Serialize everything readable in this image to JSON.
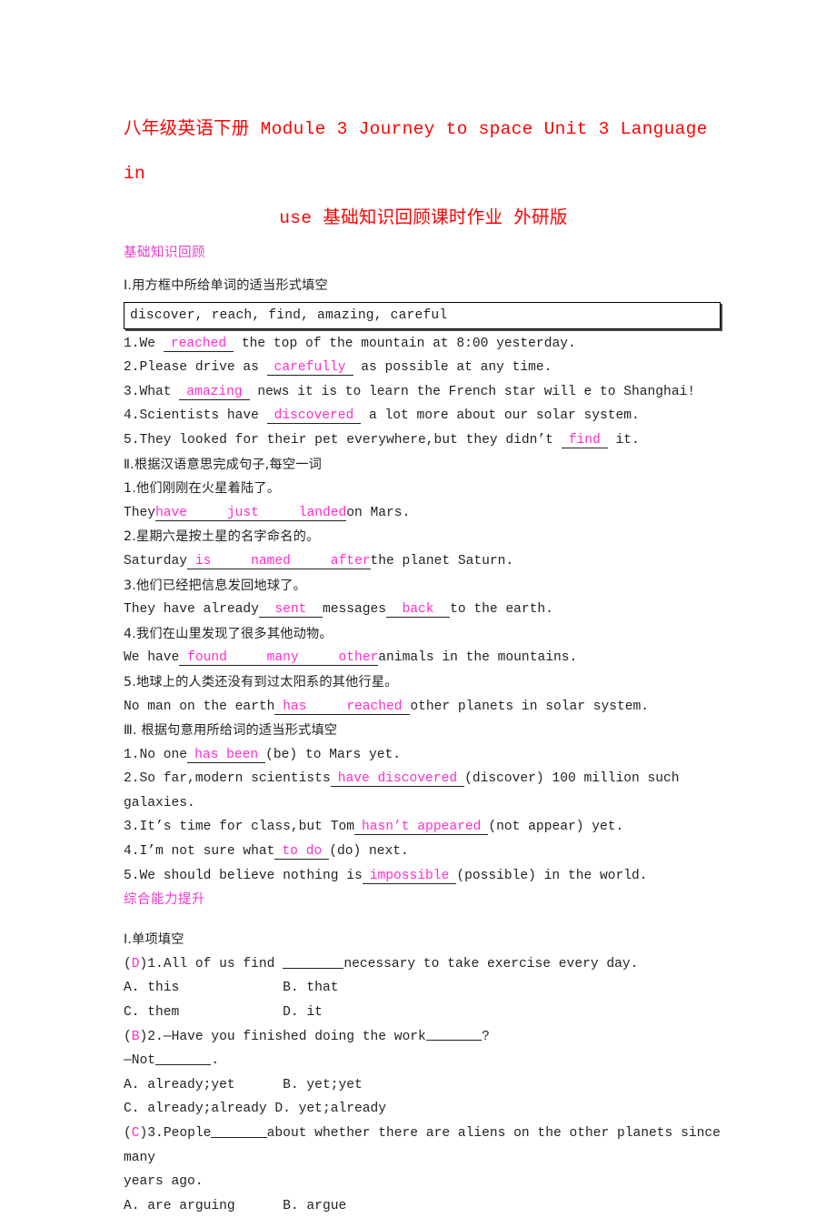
{
  "document": {
    "title_line1": "八年级英语下册 Module 3 Journey to space Unit 3 Language in",
    "title_line2": "use 基础知识回顾课时作业 外研版",
    "title_color": "#ff0000",
    "accent_color": "#ff2bd0",
    "header_color": "#ea3ad0"
  },
  "sections": {
    "basics_header": "基础知识回顾",
    "advanced_header": "综合能力提升"
  },
  "part1": {
    "heading": "Ⅰ.用方框中所给单词的适当形式填空",
    "word_bank": "discover, reach, find, amazing, careful",
    "items": [
      {
        "num": "1.",
        "before": "We ",
        "answer": "reached",
        "after": " the top of the mountain at 8:00 yesterday."
      },
      {
        "num": "2.",
        "before": "Please drive as ",
        "answer": "carefully",
        "after": " as possible at any time."
      },
      {
        "num": "3.",
        "before": "What ",
        "answer": "amazing",
        "after": " news it is to learn the French star will e to Shanghai!"
      },
      {
        "num": "4.",
        "before": "Scientists have ",
        "answer": "discovered",
        "after": " a lot more about our solar system."
      },
      {
        "num": "5.",
        "before": "They looked for their pet everywhere,but they didn’t ",
        "answer": "find",
        "after": " it."
      }
    ]
  },
  "part2": {
    "heading": "Ⅱ.根据汉语意思完成句子,每空一词",
    "items": [
      {
        "num": "1.",
        "chinese": "他们刚刚在火星着陆了。",
        "before": "They",
        "words": [
          "have",
          "just",
          "landed"
        ],
        "after": "on Mars."
      },
      {
        "num": "2.",
        "chinese": "星期六是按土星的名字命名的。",
        "before": "Saturday",
        "words": [
          "is",
          "named",
          "after"
        ],
        "after": "the planet Saturn."
      },
      {
        "num": "3.",
        "chinese": "他们已经把信息发回地球了。",
        "before": "They have already",
        "words": [
          "sent"
        ],
        "middle": "messages",
        "words2": [
          "back"
        ],
        "after": "to the earth."
      },
      {
        "num": "4.",
        "chinese": "我们在山里发现了很多其他动物。",
        "before": "We have",
        "words": [
          "found",
          "many",
          "other"
        ],
        "after": "animals in the mountains."
      },
      {
        "num": "5.",
        "chinese": "地球上的人类还没有到过太阳系的其他行星。",
        "before": "No man on the earth",
        "words": [
          "has",
          "reached"
        ],
        "after": "other planets in solar system."
      }
    ]
  },
  "part3": {
    "heading": "Ⅲ. 根据句意用所给词的适当形式填空",
    "items": [
      {
        "num": "1.",
        "before": "No one",
        "answer": "has been",
        "after": "(be) to Mars yet."
      },
      {
        "num": "2.",
        "before": "So far,modern scientists",
        "answer": "have discovered",
        "after": "(discover) 100 million such",
        "wrap": "galaxies."
      },
      {
        "num": "3.",
        "before": "It’s time for class,but Tom",
        "answer": "hasn’t appeared",
        "after": "(not appear) yet."
      },
      {
        "num": "4.",
        "before": "I’m not sure what",
        "answer": "to do",
        "after": "(do) next."
      },
      {
        "num": "5.",
        "before": "We should believe nothing is",
        "answer": "impossible",
        "after": "(possible) in the world."
      }
    ]
  },
  "part4": {
    "heading": "Ⅰ.单项填空",
    "questions": [
      {
        "answer_letter": "D",
        "num": "1.",
        "stem_before": "All of us find ",
        "stem_after": "necessary to take exercise every day.",
        "options_row1": "A. this             B. that",
        "options_row2": "C. them             D. it"
      },
      {
        "answer_letter": "B",
        "num": "2.",
        "stem_before": "—Have you finished doing the work",
        "stem_after": "?",
        "stem_line2_before": "—Not",
        "stem_line2_after": ".",
        "options_row1": "A. already;yet      B. yet;yet",
        "options_row2": "C. already;already D. yet;already"
      },
      {
        "answer_letter": "C",
        "num": "3.",
        "stem_before": "People",
        "stem_after": "about whether there are aliens on the other planets since many",
        "stem_wrap": "years ago.",
        "options_row1": "A. are arguing      B. argue"
      }
    ]
  }
}
